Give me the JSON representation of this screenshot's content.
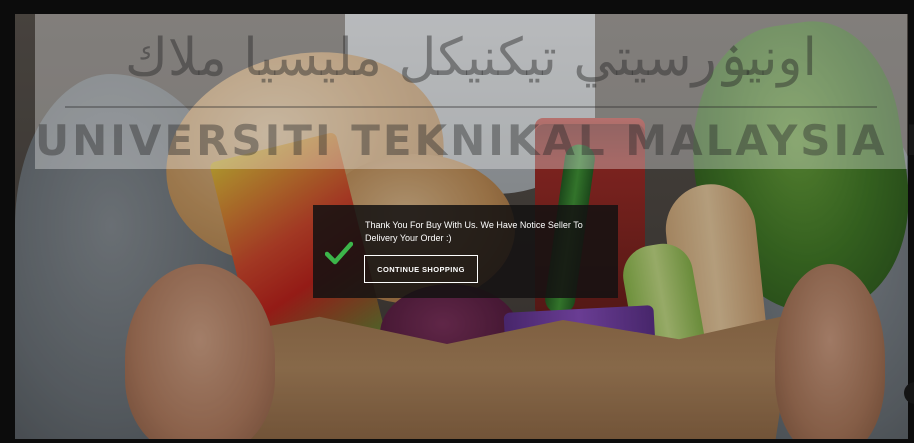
{
  "watermark": {
    "arabic": "اونيۏرسيتي تيكنيكل مليسيا ملاك",
    "latin": "UNIVERSITI TEKNIKAL MALAYSIA MELAKA"
  },
  "modal": {
    "message": "Thank You For Buy With Us. We Have Notice Seller To Delivery Your Order :)",
    "button_label": "CONTINUE SHOPPING",
    "check_icon": "checkmark-icon",
    "check_color": "#3cb54a"
  },
  "page": {
    "corner_icon": "chat-icon"
  }
}
